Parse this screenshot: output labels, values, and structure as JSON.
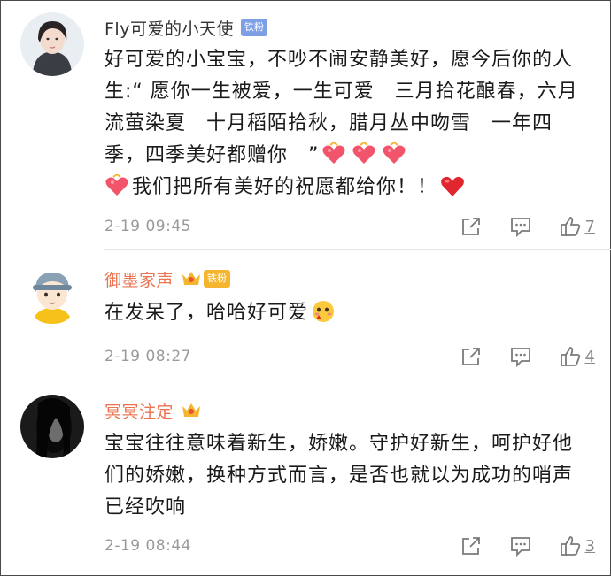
{
  "colors": {
    "name_default": "#333333",
    "name_orange": "#eb7350",
    "fan_badge_blue": "#7e9fe6",
    "fan_badge_gold": "#f5b52e",
    "timestamp": "#9a9a9a",
    "divider": "#e6e6e6"
  },
  "comments": [
    {
      "username": "Fly可爱的小天使",
      "badge": "铁粉",
      "text_part1": "好可爱的小宝宝，不吵不闹安静美好，愿今后你的人生:“ 愿你一生被爱，一生可爱　三月拾花酿春，六月流萤染夏　十月稻陌拾秋，腊月丛中吻雪　一年四季，四季美好都赠你　”",
      "text_part2": "我们把所有美好的祝愿都给你！！",
      "emojis": [
        "heart-gift-emoji",
        "heart-gift-emoji",
        "heart-gift-emoji",
        "heart-gift-emoji",
        "red-heart-emoji"
      ],
      "timestamp": "2-19 09:45",
      "likes": "7"
    },
    {
      "username": "御墨家声",
      "badge": "铁粉",
      "text": "在发呆了，哈哈好可爱",
      "emojis": [
        "blushing-face-emoji"
      ],
      "timestamp": "2-19 08:27",
      "likes": "4"
    },
    {
      "username": "冥冥注定",
      "text": "宝宝往往意味着新生，娇嫩。守护好新生，呵护好他们的娇嫩，换种方式而言，是否也就以为成功的哨声已经吹响",
      "timestamp": "2-19 08:44",
      "likes": "3"
    }
  ]
}
